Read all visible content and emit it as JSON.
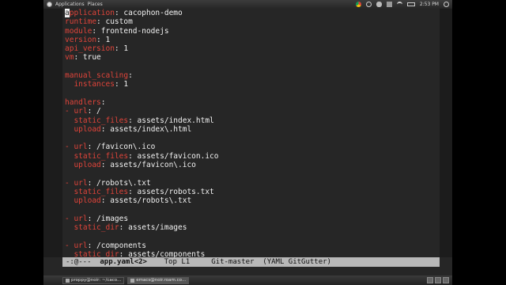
{
  "top_panel": {
    "applications": "Applications",
    "places": "Places",
    "clock": "2:53 PM"
  },
  "editor": {
    "lines": [
      [
        {
          "t": "k",
          "s": "application"
        },
        {
          "t": "v",
          "s": ": cacophon-demo"
        }
      ],
      [
        {
          "t": "k",
          "s": "runtime"
        },
        {
          "t": "v",
          "s": ": custom"
        }
      ],
      [
        {
          "t": "k",
          "s": "module"
        },
        {
          "t": "v",
          "s": ": frontend-nodejs"
        }
      ],
      [
        {
          "t": "k",
          "s": "version"
        },
        {
          "t": "v",
          "s": ": 1"
        }
      ],
      [
        {
          "t": "k",
          "s": "api_version"
        },
        {
          "t": "v",
          "s": ": 1"
        }
      ],
      [
        {
          "t": "k",
          "s": "vm"
        },
        {
          "t": "v",
          "s": ": true"
        }
      ],
      [],
      [
        {
          "t": "k",
          "s": "manual_scaling"
        },
        {
          "t": "v",
          "s": ":"
        }
      ],
      [
        {
          "t": "v",
          "s": "  "
        },
        {
          "t": "k",
          "s": "instances"
        },
        {
          "t": "v",
          "s": ": 1"
        }
      ],
      [],
      [
        {
          "t": "k",
          "s": "handlers"
        },
        {
          "t": "v",
          "s": ":"
        }
      ],
      [
        {
          "t": "k",
          "s": "- url"
        },
        {
          "t": "v",
          "s": ": /"
        }
      ],
      [
        {
          "t": "v",
          "s": "  "
        },
        {
          "t": "k",
          "s": "static_files"
        },
        {
          "t": "v",
          "s": ": assets/index.html"
        }
      ],
      [
        {
          "t": "v",
          "s": "  "
        },
        {
          "t": "k",
          "s": "upload"
        },
        {
          "t": "v",
          "s": ": assets/index\\.html"
        }
      ],
      [],
      [
        {
          "t": "k",
          "s": "- url"
        },
        {
          "t": "v",
          "s": ": /favicon\\.ico"
        }
      ],
      [
        {
          "t": "v",
          "s": "  "
        },
        {
          "t": "k",
          "s": "static_files"
        },
        {
          "t": "v",
          "s": ": assets/favicon.ico"
        }
      ],
      [
        {
          "t": "v",
          "s": "  "
        },
        {
          "t": "k",
          "s": "upload"
        },
        {
          "t": "v",
          "s": ": assets/favicon\\.ico"
        }
      ],
      [],
      [
        {
          "t": "k",
          "s": "- url"
        },
        {
          "t": "v",
          "s": ": /robots\\.txt"
        }
      ],
      [
        {
          "t": "v",
          "s": "  "
        },
        {
          "t": "k",
          "s": "static_files"
        },
        {
          "t": "v",
          "s": ": assets/robots.txt"
        }
      ],
      [
        {
          "t": "v",
          "s": "  "
        },
        {
          "t": "k",
          "s": "upload"
        },
        {
          "t": "v",
          "s": ": assets/robots\\.txt"
        }
      ],
      [],
      [
        {
          "t": "k",
          "s": "- url"
        },
        {
          "t": "v",
          "s": ": /images"
        }
      ],
      [
        {
          "t": "v",
          "s": "  "
        },
        {
          "t": "k",
          "s": "static_dir"
        },
        {
          "t": "v",
          "s": ": assets/images"
        }
      ],
      [],
      [
        {
          "t": "k",
          "s": "- url"
        },
        {
          "t": "v",
          "s": ": /components"
        }
      ],
      [
        {
          "t": "v",
          "s": "  "
        },
        {
          "t": "k",
          "s": "static_dir"
        },
        {
          "t": "v",
          "s": ": assets/components"
        }
      ]
    ]
  },
  "modeline": {
    "status": "-:@---  ",
    "buffer": "app.yaml<2>",
    "position": "    Top L1     ",
    "vc": "Git-master  ",
    "modes": "(YAML GitGutter)"
  },
  "taskbar": {
    "tasks": [
      {
        "label": "proppy@noir: ~/caco...",
        "active": false
      },
      {
        "label": "emacs@noir.roam.co...",
        "active": true
      }
    ]
  },
  "colors": {
    "key": "#e0443a",
    "text": "#f2f2f2",
    "background": "#262626",
    "modeline": "#b8b8b8"
  }
}
